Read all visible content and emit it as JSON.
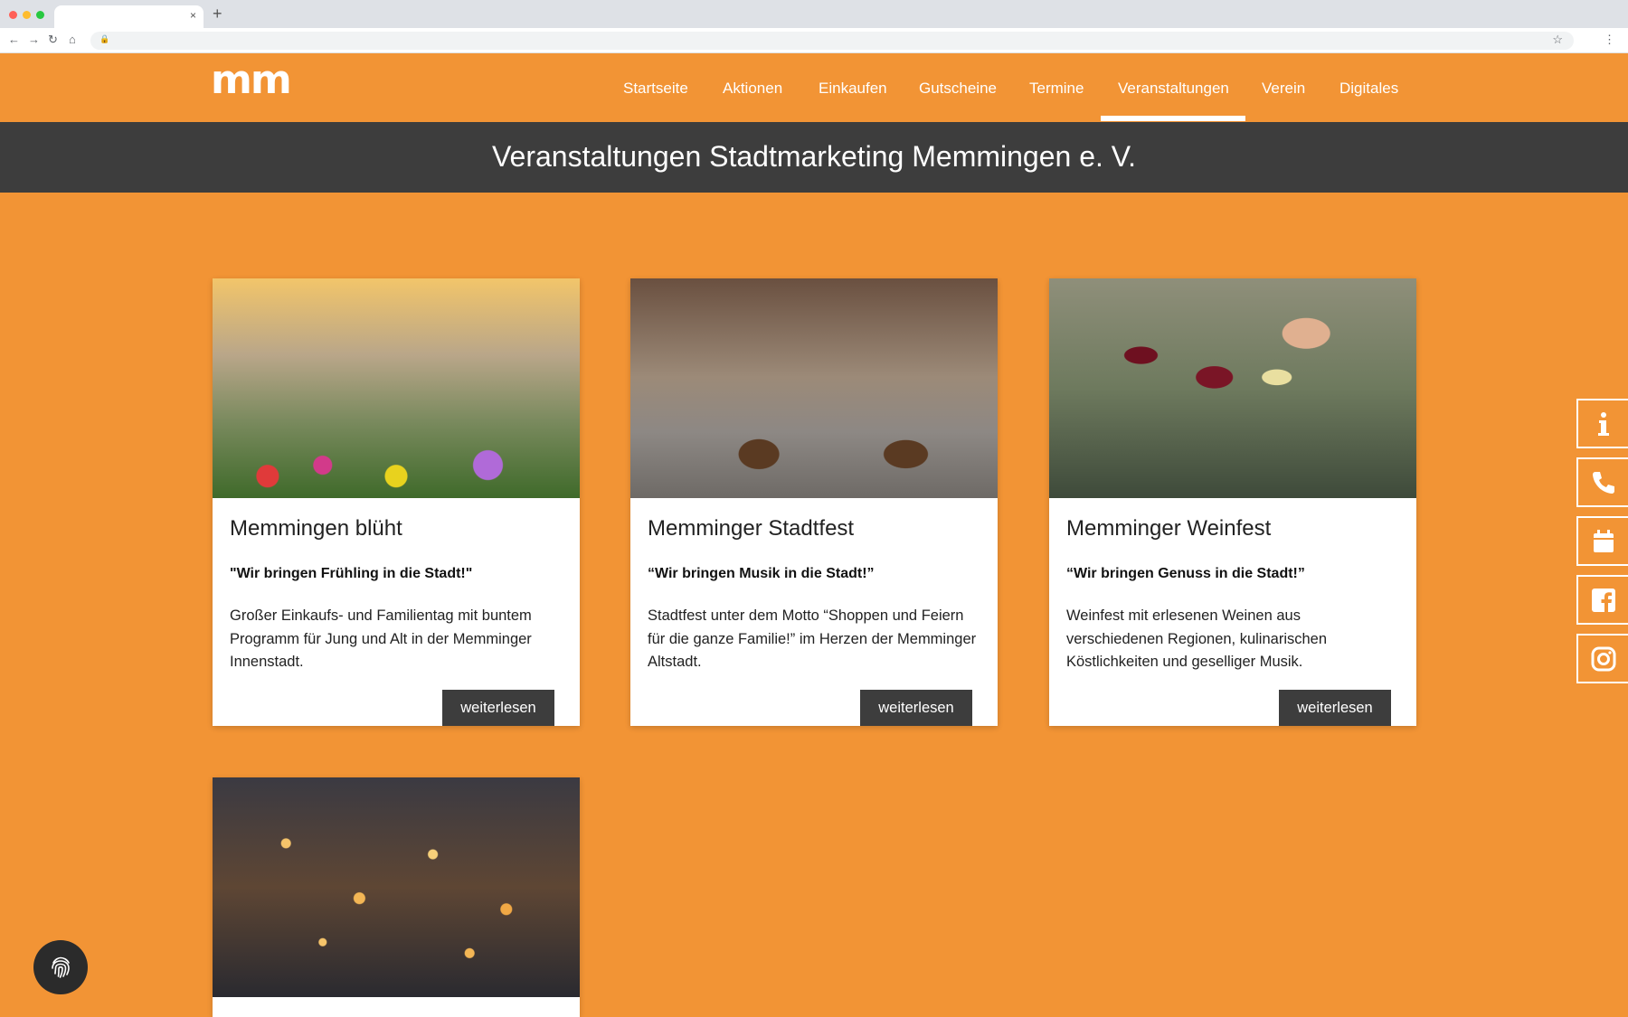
{
  "browser": {
    "tab_close": "×",
    "new_tab": "+",
    "back": "←",
    "forward": "→",
    "reload": "↻",
    "home": "⌂",
    "lock": "🔒",
    "star": "☆",
    "menu": "⋮"
  },
  "header": {
    "logo": "mm",
    "nav": [
      {
        "label": "Startseite",
        "active": false
      },
      {
        "label": "Aktionen",
        "active": false
      },
      {
        "label": "Einkaufen",
        "active": false
      },
      {
        "label": "Gutscheine",
        "active": false
      },
      {
        "label": "Termine",
        "active": false
      },
      {
        "label": "Veranstaltungen",
        "active": true
      },
      {
        "label": "Verein",
        "active": false
      },
      {
        "label": "Digitales",
        "active": false
      }
    ]
  },
  "page_title": "Veranstaltungen Stadtmarketing Memmingen e. V.",
  "cards": [
    {
      "title": "Memmingen blüht",
      "quote": "\"Wir bringen Frühling in die Stadt!\"",
      "text": "Großer Einkaufs- und Familientag mit buntem Programm für Jung und Alt in der Memminger Innenstadt.",
      "button": "weiterlesen"
    },
    {
      "title": "Memminger Stadtfest",
      "quote": "“Wir bringen Musik in die Stadt!”",
      "text": "Stadtfest unter dem Motto “Shoppen und Feiern für die ganze Familie!” im Herzen der Memminger Altstadt.",
      "button": "weiterlesen"
    },
    {
      "title": "Memminger Weinfest",
      "quote": "“Wir bringen Genuss in die Stadt!”",
      "text": "Weinfest mit erlesenen Weinen aus verschiedenen Regionen, kulinarischen Köstlichkeiten und geselliger Musik.",
      "button": "weiterlesen"
    }
  ],
  "side_buttons": [
    "info-icon",
    "phone-icon",
    "calendar-icon",
    "facebook-icon",
    "instagram-icon"
  ],
  "colors": {
    "brand_orange": "#f29435",
    "dark_band": "#3d3d3d",
    "white": "#ffffff"
  }
}
